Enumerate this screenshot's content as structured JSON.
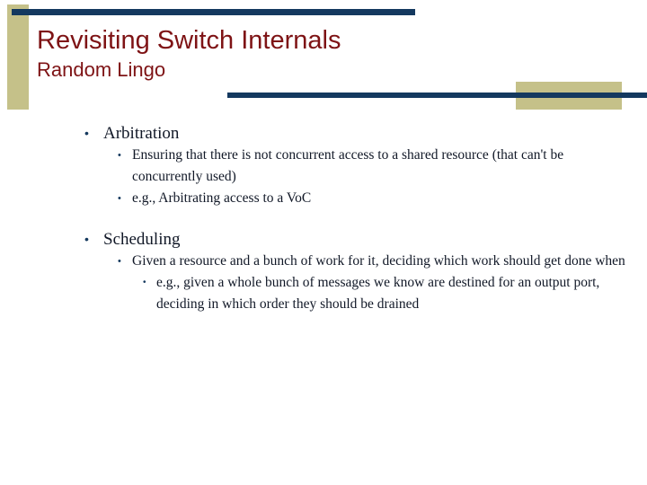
{
  "slide": {
    "title": "Revisiting Switch Internals",
    "subtitle": "Random Lingo",
    "colors": {
      "title_text": "#7e1315",
      "accent_navy": "#14395f",
      "accent_khaki": "#c5c189",
      "body_text": "#111827",
      "background": "#ffffff"
    },
    "bullet_glyph": "•",
    "content": [
      {
        "level": 1,
        "text": "Arbitration",
        "children": [
          {
            "level": 2,
            "text": "Ensuring that there is not concurrent access to a shared resource (that can't be concurrently used)"
          },
          {
            "level": 2,
            "text": "e.g., Arbitrating access to a VoC"
          }
        ]
      },
      {
        "level": 1,
        "text": "Scheduling",
        "children": [
          {
            "level": 2,
            "text": "Given a resource and a bunch of work for it, deciding which work should get done when"
          },
          {
            "level": 3,
            "text": "e.g., given a whole bunch of messages we know are destined for an output port, deciding in which order they should be drained"
          }
        ]
      }
    ]
  }
}
